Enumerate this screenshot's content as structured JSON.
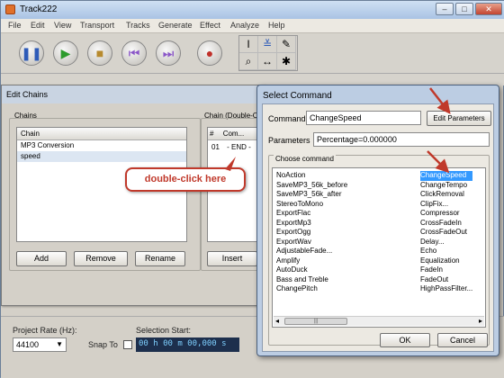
{
  "app": {
    "title": "Track222"
  },
  "menu": [
    "File",
    "Edit",
    "View",
    "Transport",
    "Tracks",
    "Generate",
    "Effect",
    "Analyze",
    "Help"
  ],
  "chains_dialog": {
    "title": "Edit Chains",
    "chains_group": "Chains",
    "chain_group": "Chain (Double-Cl",
    "list_header": "Chain",
    "items": [
      "MP3 Conversion",
      "speed"
    ],
    "chain_cols": [
      "#",
      "Com..."
    ],
    "chain_rows": [
      {
        "num": "01",
        "cmd": "- END -"
      }
    ],
    "buttons": {
      "add": "Add",
      "remove": "Remove",
      "rename": "Rename",
      "insert": "Insert"
    }
  },
  "select_dialog": {
    "title": "Select Command",
    "command_label": "Command",
    "command_value": "ChangeSpeed",
    "edit_params": "Edit Parameters",
    "params_label": "Parameters",
    "params_value": "Percentage=0.000000",
    "choose_label": "Choose command",
    "col1": [
      "NoAction",
      "SaveMP3_56k_before",
      "SaveMP3_56k_after",
      "StereoToMono",
      "ExportFlac",
      "ExportMp3",
      "ExportOgg",
      "ExportWav",
      "AdjustableFade...",
      "Amplify",
      "AutoDuck",
      "Bass and Treble",
      "ChangePitch"
    ],
    "col2": [
      "ChangeSpeed",
      "ChangeTempo",
      "ClickRemoval",
      "ClipFix...",
      "Compressor",
      "CrossFadeIn",
      "CrossFadeOut",
      "Delay...",
      "Echo",
      "Equalization",
      "FadeIn",
      "FadeOut",
      "HighPassFilter..."
    ],
    "ok": "OK",
    "cancel": "Cancel"
  },
  "annotation": "double-click here",
  "bottom": {
    "project_rate_label": "Project Rate (Hz):",
    "project_rate": "44100",
    "snap_to": "Snap To",
    "selection_start": "Selection Start:",
    "time_value": "00 h 00 m 00,000 s"
  },
  "colors": {
    "highlight": "#3399ff",
    "arrow": "#c0392b",
    "annotation": "#c0392b"
  }
}
